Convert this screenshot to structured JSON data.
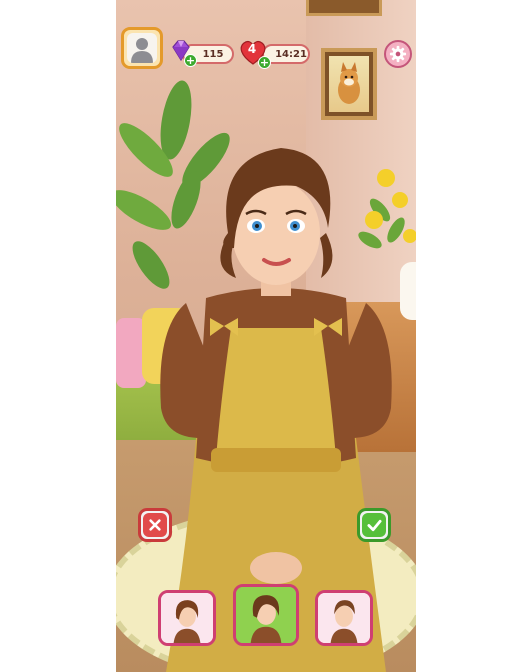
{
  "hud": {
    "gems": "115",
    "gem_plus": "+",
    "lives": "4",
    "life_plus": "+",
    "timer": "14:21"
  },
  "icons": {
    "profile": "avatar-icon",
    "gem": "diamond-icon",
    "heart": "heart-icon",
    "settings": "gear-icon",
    "reject": "close-icon",
    "confirm": "check-icon"
  },
  "colors": {
    "reject": "#e14a4a",
    "confirm": "#56bf3a",
    "option_border": "#cf3f72",
    "selected_bg": "#8fd14f"
  },
  "hairstyle_options": [
    {
      "name": "hairstyle-option-1",
      "selected": false
    },
    {
      "name": "hairstyle-option-2",
      "selected": true
    },
    {
      "name": "hairstyle-option-3",
      "selected": false
    }
  ]
}
